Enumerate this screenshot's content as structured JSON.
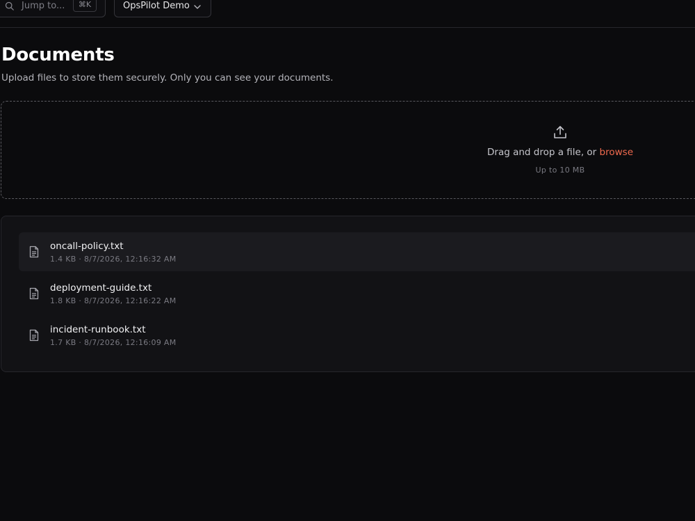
{
  "topbar": {
    "search": {
      "placeholder": "Jump to...",
      "shortcut": "⌘K",
      "icon": "search-icon"
    },
    "workspace": {
      "label": "OpsPilot Demo",
      "icon": "chevron-down-icon"
    }
  },
  "page": {
    "title": "Documents",
    "subtitle": "Upload files to store them securely. Only you can see your documents."
  },
  "dropzone": {
    "icon": "upload-icon",
    "text": "Drag and drop a file, or ",
    "browse_label": "browse",
    "limit": "Up to 10 MB"
  },
  "files": [
    {
      "name": "oncall-policy.txt",
      "size": "1.4 KB",
      "date": "8/7/2026, 12:16:32 AM",
      "meta": "1.4 KB · 8/7/2026, 12:16:32 AM",
      "icon": "file-text-icon"
    },
    {
      "name": "deployment-guide.txt",
      "size": "1.8 KB",
      "date": "8/7/2026, 12:16:22 AM",
      "meta": "1.8 KB · 8/7/2026, 12:16:22 AM",
      "icon": "file-text-icon"
    },
    {
      "name": "incident-runbook.txt",
      "size": "1.7 KB",
      "date": "8/7/2026, 12:16:09 AM",
      "meta": "1.7 KB · 8/7/2026, 12:16:09 AM",
      "icon": "file-text-icon"
    }
  ],
  "colors": {
    "background": "#0b0b0d",
    "panel": "#121215",
    "accent": "#f06a4e",
    "text_primary": "#f2f2f4",
    "text_muted": "#7a7a82"
  }
}
